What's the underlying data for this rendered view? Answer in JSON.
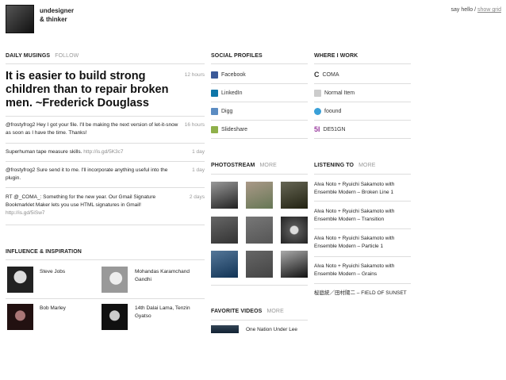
{
  "header": {
    "name_line1": "undesigner",
    "name_line2": "& thinker",
    "say_hello": "say hello",
    "separator": "/",
    "show_grid": "show grid"
  },
  "musings": {
    "title": "DAILY MUSINGS",
    "follow": "FOLLOW",
    "featured": "It is easier to build strong children than to repair broken men. ~Frederick Douglass",
    "featured_time": "12 hours",
    "items": [
      {
        "text": "@frostyfrog2 Hey I got your file. I'll be making the next version of let-it-snow as soon as I have the time. Thanks!",
        "time": "16 hours"
      },
      {
        "text": "Superhuman tape measure skills.",
        "link": "http://is.gd/5K3c7",
        "time": "1 day"
      },
      {
        "text": "@frostyfrog2 Sure send it to me. I'll incorporate anything useful into the plugin.",
        "time": "1 day"
      },
      {
        "text": "RT @_COMA_: Something for the new year. Our Gmail Signature Bookmarklet Maker lets you use HTML signatures in Gmail!",
        "link": "http://is.gd/5iSw7",
        "time": "2 days"
      }
    ]
  },
  "influence": {
    "title": "INFLUENCE & INSPIRATION",
    "people": [
      {
        "name": "Steve Jobs"
      },
      {
        "name": "Mohandas Karamchand Gandhi"
      },
      {
        "name": "Bob Marley"
      },
      {
        "name": "14th Dalai Lama, Tenzin Gyatso"
      }
    ]
  },
  "social": {
    "title": "SOCIAL PROFILES",
    "items": [
      {
        "label": "Facebook",
        "icon": "facebook-icon",
        "color": "#3b5998"
      },
      {
        "label": "LinkedIn",
        "icon": "linkedin-icon",
        "color": "#0e76a8"
      },
      {
        "label": "Digg",
        "icon": "digg-icon",
        "color": "#5b8cc2"
      },
      {
        "label": "Slideshare",
        "icon": "slideshare-icon",
        "color": "#8fb04a"
      }
    ]
  },
  "work": {
    "title": "WHERE I WORK",
    "items": [
      {
        "label": "COMA",
        "icon": "coma-icon",
        "color": "#222"
      },
      {
        "label": "Normal Item",
        "icon": "normal-item-icon",
        "color": "#bbb"
      },
      {
        "label": "foound",
        "icon": "foound-icon",
        "color": "#3aa0d8"
      },
      {
        "label": "DE51GN",
        "icon": "de51gn-icon",
        "color": "#9b3fa0"
      }
    ]
  },
  "photostream": {
    "title": "PHOTOSTREAM",
    "more": "MORE"
  },
  "listening": {
    "title": "LISTENING TO",
    "more": "MORE",
    "items": [
      "Alva Noto + Ryuichi Sakamoto with Ensemble Modern – Broken Line 1",
      "Alva Noto + Ryuichi Sakamoto with Ensemble Modern – Transition",
      "Alva Noto + Ryuichi Sakamoto with Ensemble Modern – Particle 1",
      "Alva Noto + Ryuichi Sakamoto with Ensemble Modern – Grains",
      "桜庭統／田村陽二 – FIELD OF SUNSET"
    ]
  },
  "videos": {
    "title": "FAVORITE VIDEOS",
    "more": "MORE",
    "first": "One Nation Under Lee"
  }
}
